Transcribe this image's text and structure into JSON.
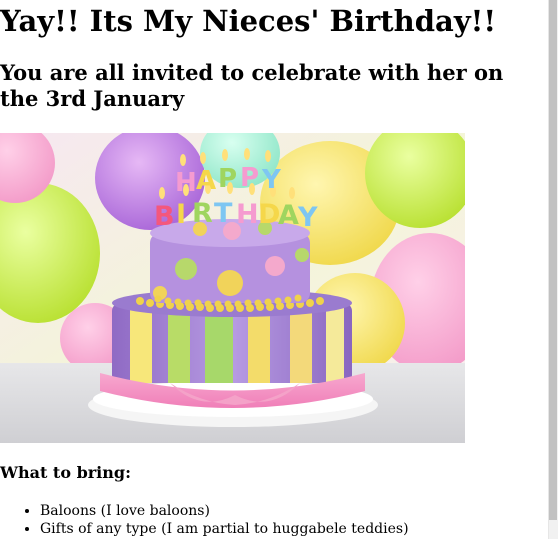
{
  "page": {
    "heading": "Yay!! Its My Nieces' Birthday!!",
    "subheading": "You are all invited to celebrate with her on the 3rd January",
    "hero_image": {
      "alt_text": "",
      "banner_letters": [
        "H",
        "A",
        "P",
        "P",
        "Y",
        "B",
        "I",
        "R",
        "T",
        "H",
        "D",
        "A",
        "Y"
      ]
    },
    "bring_heading": "What to bring:",
    "bring_items": [
      "Baloons (I love baloons)",
      "Gifts of any type (I am partial to huggabele teddies)"
    ]
  }
}
